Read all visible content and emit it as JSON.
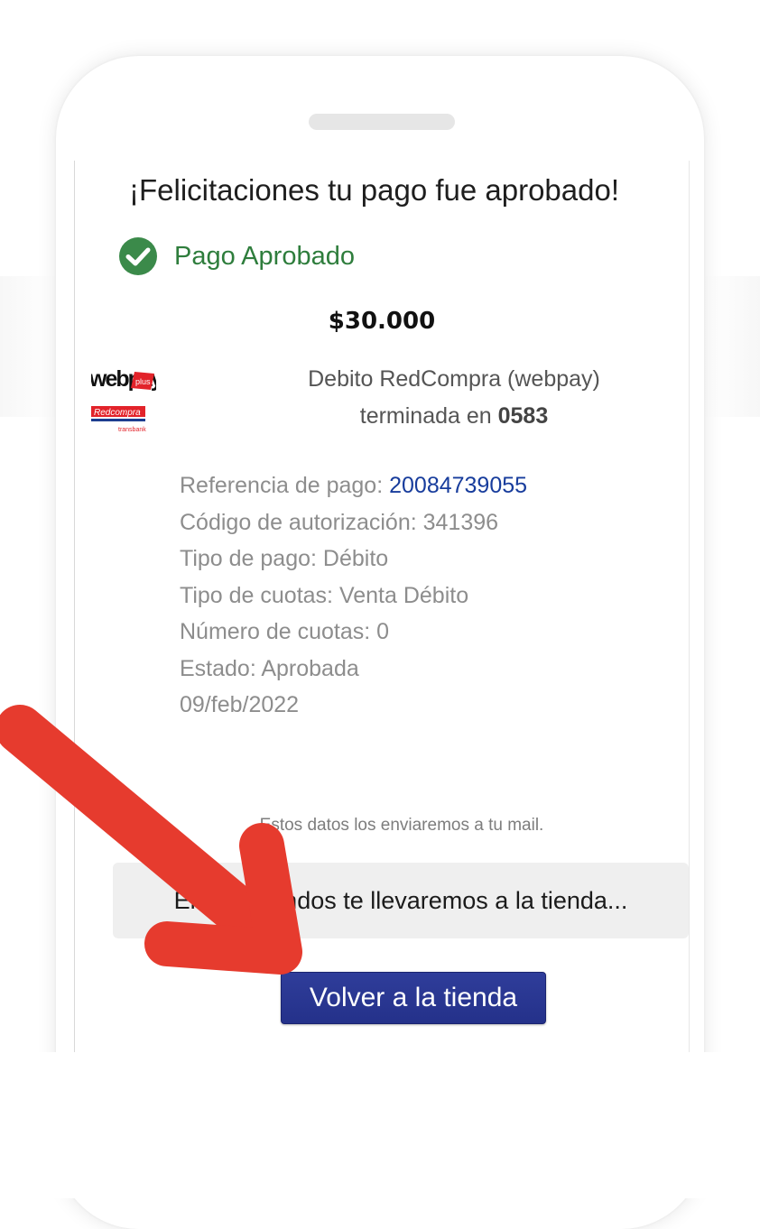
{
  "page": {
    "title": "¡Felicitaciones tu pago fue aprobado!",
    "status": "Pago Aprobado",
    "amount": "$30.000"
  },
  "payment_method": {
    "line1": "Debito RedCompra (webpay)",
    "line2_prefix": "terminada en ",
    "card_last_digits": "0583",
    "logo_text": {
      "webpay": "webpay",
      "plus": "plus",
      "redcompra": "Redcompra",
      "transbank": "transbank"
    }
  },
  "details": {
    "reference_label": "Referencia de pago: ",
    "reference_value": "20084739055",
    "authorization": "Código de autorización: 341396",
    "payment_type": "Tipo de pago: Débito",
    "installment_type": "Tipo de cuotas: Venta Débito",
    "installments": "Número de cuotas: 0",
    "state": "Estado: Aprobada",
    "date": "09/feb/2022"
  },
  "mail_note": "Estos datos los enviaremos a tu mail.",
  "redirect_message": "En 6 segundos te llevaremos a la tienda...",
  "back_button_label": "Volver a la tienda",
  "colors": {
    "approved_green": "#2e7d3c",
    "button_blue": "#2a3690",
    "reference_blue": "#173c9c",
    "annotation_arrow_red": "#e63b2e"
  },
  "icons": {
    "status": "check-circle-icon",
    "annotation": "arrow-annotation"
  }
}
